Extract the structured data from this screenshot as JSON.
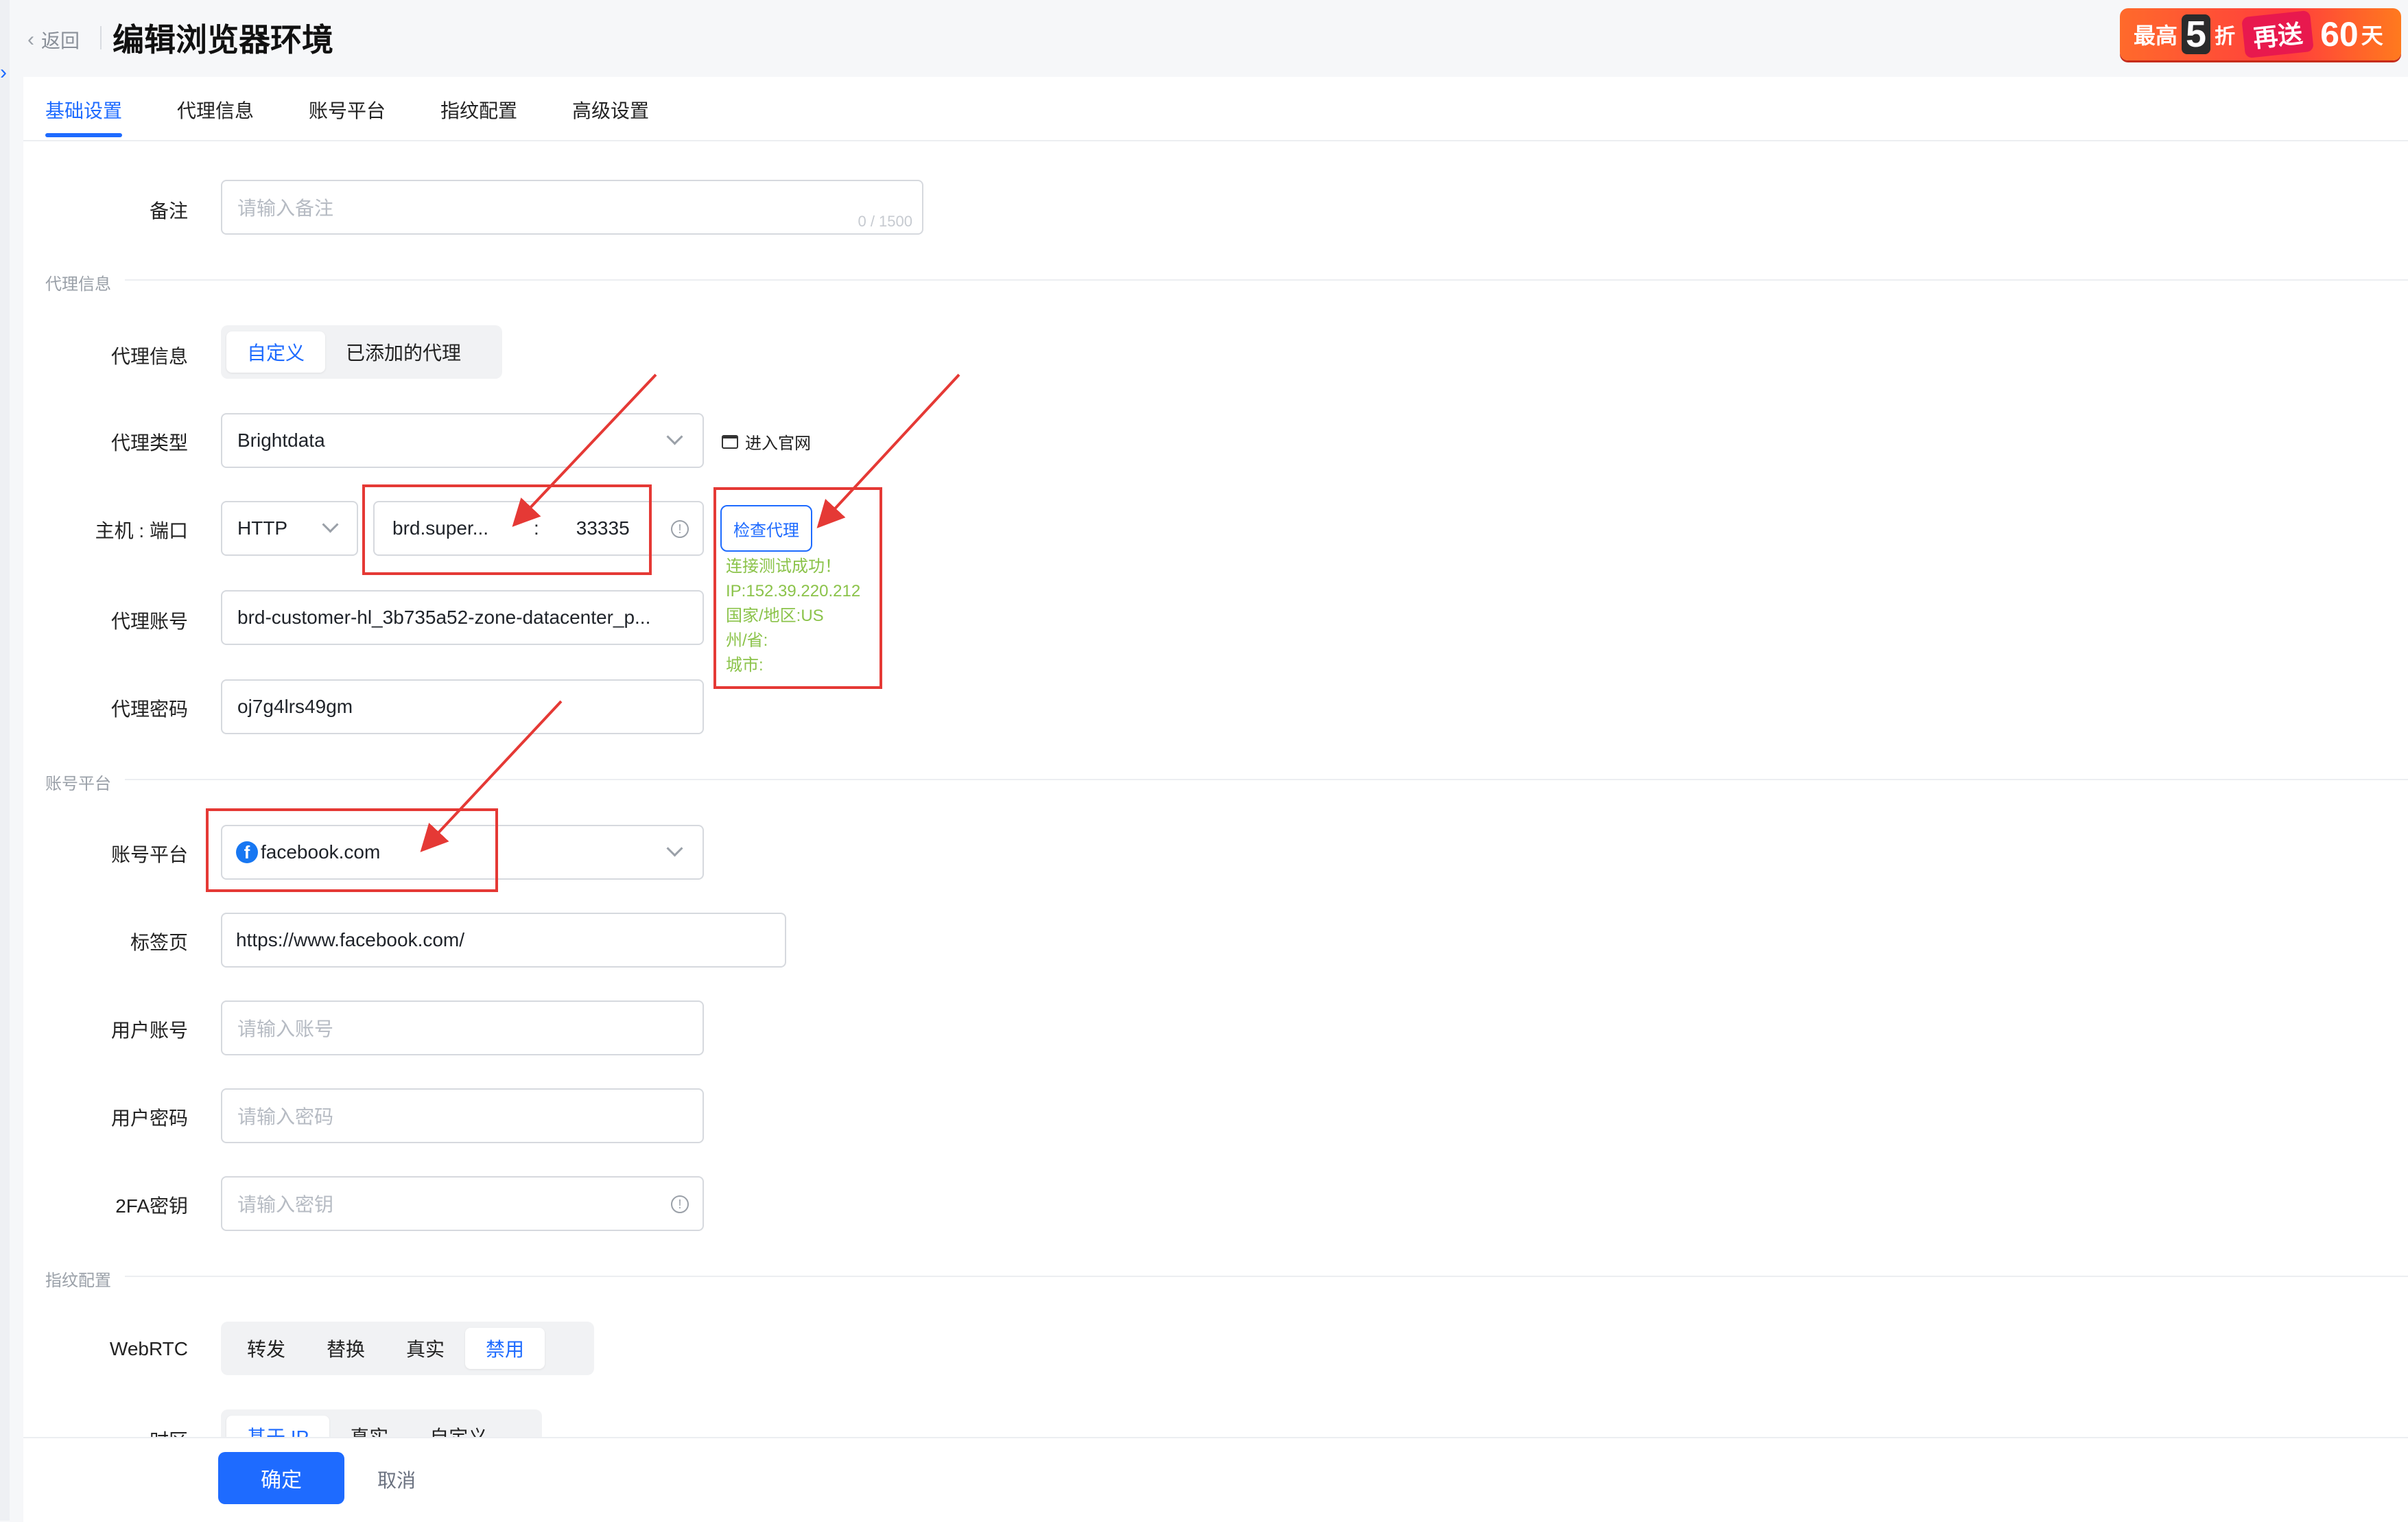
{
  "header": {
    "back_label": "返回",
    "title": "编辑浏览器环境",
    "promo": {
      "p1": "最高",
      "big": "5",
      "p2": "折",
      "tag": "再送",
      "big2": "60",
      "p3": "天"
    }
  },
  "tabs": [
    {
      "label": "基础设置",
      "active": true
    },
    {
      "label": "代理信息"
    },
    {
      "label": "账号平台"
    },
    {
      "label": "指纹配置"
    },
    {
      "label": "高级设置"
    }
  ],
  "remark": {
    "label": "备注",
    "placeholder": "请输入备注",
    "counter": "0 / 1500"
  },
  "sections": {
    "proxy": "代理信息",
    "account": "账号平台",
    "fingerprint": "指纹配置"
  },
  "proxy": {
    "info_label": "代理信息",
    "info_options": [
      "自定义",
      "已添加的代理"
    ],
    "info_selected": "自定义",
    "type_label": "代理类型",
    "type_value": "Brightdata",
    "official_site": "进入官网",
    "host_label": "主机 : 端口",
    "protocol": "HTTP",
    "host": "brd.super...",
    "colon": ":",
    "port": "33335",
    "check_button": "检查代理",
    "result_lines": [
      "连接测试成功！",
      "IP:152.39.220.212",
      "国家/地区:US",
      "州/省:",
      "城市:"
    ],
    "account_label": "代理账号",
    "account_value": "brd-customer-hl_3b735a52-zone-datacenter_p...",
    "password_label": "代理密码",
    "password_value": "oj7g4lrs49gm"
  },
  "account": {
    "platform_label": "账号平台",
    "platform_value": "facebook.com",
    "platform_icon": "facebook-icon",
    "tab_label": "标签页",
    "tab_value": "https://www.facebook.com/",
    "user_label": "用户账号",
    "user_placeholder": "请输入账号",
    "pass_label": "用户密码",
    "pass_placeholder": "请输入密码",
    "twofa_label": "2FA密钥",
    "twofa_placeholder": "请输入密钥"
  },
  "fingerprint": {
    "webrtc_label": "WebRTC",
    "webrtc_options": [
      "转发",
      "替换",
      "真实",
      "禁用"
    ],
    "webrtc_selected": "禁用",
    "timezone_label": "时区",
    "timezone_options": [
      "基于 IP",
      "真实",
      "自定义"
    ],
    "timezone_selected": "基于 IP"
  },
  "footer": {
    "confirm": "确定",
    "cancel": "取消"
  },
  "colors": {
    "accent": "#1e6bff",
    "success": "#8bc34a",
    "annotation": "#e53935"
  }
}
